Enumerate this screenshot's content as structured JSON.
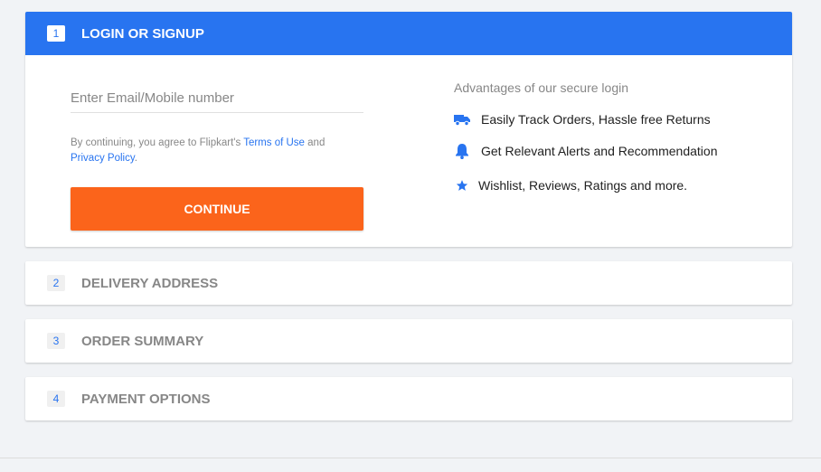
{
  "colors": {
    "primary_blue": "#2874f0",
    "continue_orange": "#fb641b",
    "page_bg": "#f1f3f6"
  },
  "login_step": {
    "number": "1",
    "title": "LOGIN OR SIGNUP",
    "input_placeholder": "Enter Email/Mobile number",
    "input_value": "",
    "terms_prefix": "By continuing, you agree to Flipkart's ",
    "terms_link": "Terms of Use",
    "terms_and": " and",
    "privacy_link": "Privacy Policy",
    "terms_suffix": ".",
    "continue_label": "CONTINUE"
  },
  "advantages": {
    "title": "Advantages of our secure login",
    "items": [
      {
        "icon": "truck-icon",
        "label": "Easily Track Orders, Hassle free Returns"
      },
      {
        "icon": "bell-icon",
        "label": "Get Relevant Alerts and Recommendation"
      },
      {
        "icon": "star-icon",
        "label": "Wishlist, Reviews, Ratings and more."
      }
    ]
  },
  "steps": [
    {
      "number": "2",
      "title": "DELIVERY ADDRESS"
    },
    {
      "number": "3",
      "title": "ORDER SUMMARY"
    },
    {
      "number": "4",
      "title": "PAYMENT OPTIONS"
    }
  ]
}
